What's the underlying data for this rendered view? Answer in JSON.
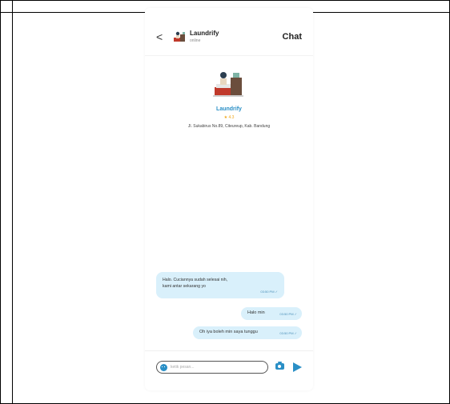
{
  "header": {
    "back_label": "<",
    "name": "Laundrify",
    "status": "online",
    "title": "Chat"
  },
  "profile": {
    "name": "Laundrify",
    "rating": "4.3",
    "address": "Jl. Sukabirus No.89, Citeureup, Kab. Bandung"
  },
  "messages": [
    {
      "direction": "in",
      "text_line1": "Halo. Cuciannya sudah selesai nih,",
      "text_line2": "kami antar sekarang yo",
      "time": "03:50 PM ✓"
    },
    {
      "direction": "out",
      "text": "Halo min",
      "time": "03:50 PM ✓"
    },
    {
      "direction": "out",
      "text": "Oh iya boleh min saya tunggu",
      "time": "03:50 PM ✓"
    }
  ],
  "composer": {
    "placeholder": "ketik pesan..."
  },
  "icons": {
    "back": "chevron-left-icon",
    "emoji": "emoji-icon",
    "camera": "camera-icon",
    "send": "send-icon"
  },
  "colors": {
    "accent": "#2a8fc6",
    "bubble": "#d9f0fb",
    "star": "#f0a81c"
  }
}
